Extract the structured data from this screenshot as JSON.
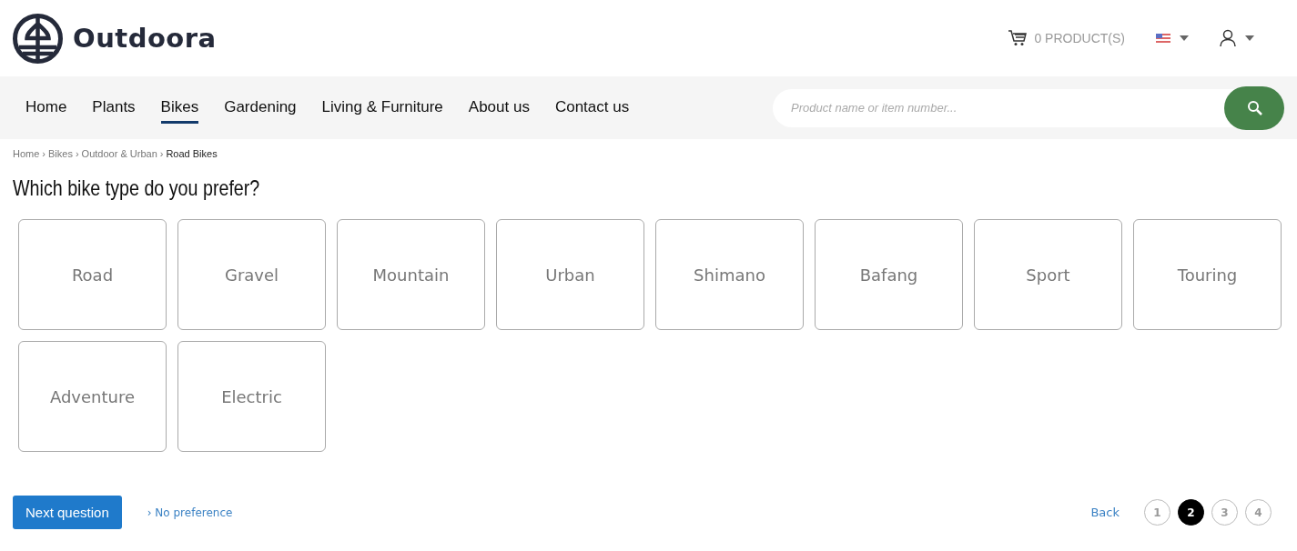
{
  "header": {
    "logo": "Outdoora",
    "cart": "0 PRODUCT(S)"
  },
  "nav": [
    {
      "label": "Home",
      "selected": false
    },
    {
      "label": "Plants",
      "selected": false
    },
    {
      "label": "Bikes",
      "selected": true
    },
    {
      "label": "Gardening",
      "selected": false
    },
    {
      "label": "Living & Furniture",
      "selected": false
    },
    {
      "label": "About us",
      "selected": false
    },
    {
      "label": "Contact us",
      "selected": false
    }
  ],
  "search": {
    "placeholder": "Product name or item number..."
  },
  "breadcrumb": {
    "separator": "›",
    "items": [
      {
        "label": "Home",
        "current": false
      },
      {
        "label": "Bikes",
        "current": false
      },
      {
        "label": "Outdoor & Urban",
        "current": false
      },
      {
        "label": "Road Bikes",
        "current": true
      }
    ]
  },
  "question": "Which bike type do you prefer?",
  "options": [
    {
      "label": "Road",
      "selected": false
    },
    {
      "label": "Gravel",
      "selected": false
    },
    {
      "label": "Mountain",
      "selected": false
    },
    {
      "label": "Urban",
      "selected": false
    },
    {
      "label": "Shimano",
      "selected": false
    },
    {
      "label": "Bafang",
      "selected": false
    },
    {
      "label": "Sport",
      "selected": false
    },
    {
      "label": "Touring",
      "selected": false
    },
    {
      "label": "Adventure",
      "selected": false
    },
    {
      "label": "Electric",
      "selected": false
    }
  ],
  "footer": {
    "next": "Next question",
    "skip": "› No preference",
    "back": "Back"
  },
  "steps": [
    {
      "label": "1",
      "selected": false
    },
    {
      "label": "2",
      "selected": true
    },
    {
      "label": "3",
      "selected": false
    },
    {
      "label": "4",
      "selected": false
    }
  ]
}
